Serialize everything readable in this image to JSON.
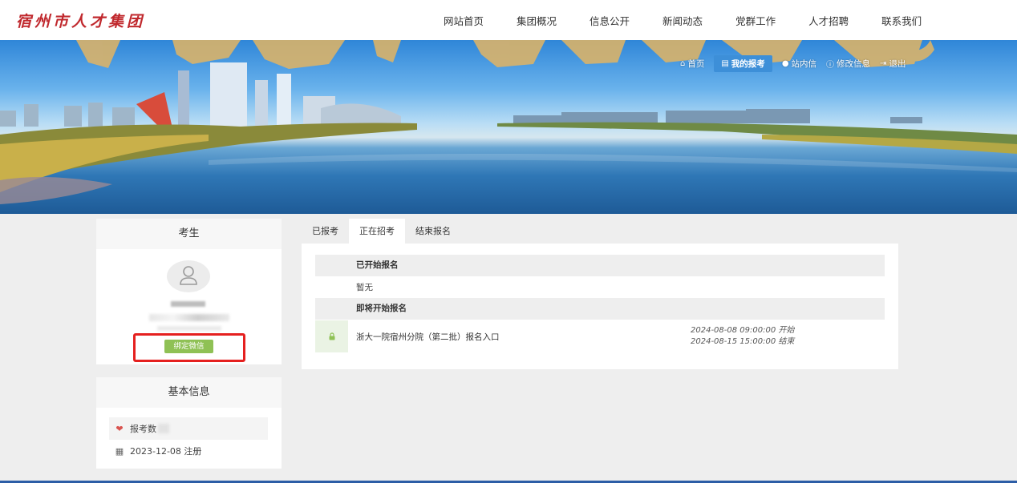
{
  "header": {
    "logo": "宿州市人才集团",
    "nav": [
      "网站首页",
      "集团概况",
      "信息公开",
      "新闻动态",
      "党群工作",
      "人才招聘",
      "联系我们"
    ]
  },
  "banner": {
    "nav": [
      {
        "label": "首页",
        "icon": "home-icon",
        "active": false
      },
      {
        "label": "我的报考",
        "icon": "id-card-icon",
        "active": true
      },
      {
        "label": "站内信",
        "icon": "chat-icon",
        "active": false
      },
      {
        "label": "修改信息",
        "icon": "info-icon",
        "active": false
      },
      {
        "label": "退出",
        "icon": "logout-icon",
        "active": false
      }
    ]
  },
  "profile": {
    "title": "考生",
    "bind_button": "绑定微信"
  },
  "basic_info": {
    "title": "基本信息",
    "apply_count_label": "报考数",
    "register_date": "2023-12-08 注册"
  },
  "tabs": [
    "已报考",
    "正在招考",
    "结束报名"
  ],
  "active_tab": "正在招考",
  "sections": {
    "started": {
      "title": "已开始报名",
      "empty": "暂无"
    },
    "upcoming": {
      "title": "即将开始报名",
      "items": [
        {
          "title": "浙大一院宿州分院（第二批）报名入口",
          "start": "2024-08-08 09:00:00 开始",
          "end": "2024-08-15 15:00:00 结束"
        }
      ]
    }
  },
  "colors": {
    "accent": "#3d8fd8",
    "wechat_green": "#8fc155",
    "highlight_red": "#e5201f",
    "logo_red": "#c0282d"
  }
}
